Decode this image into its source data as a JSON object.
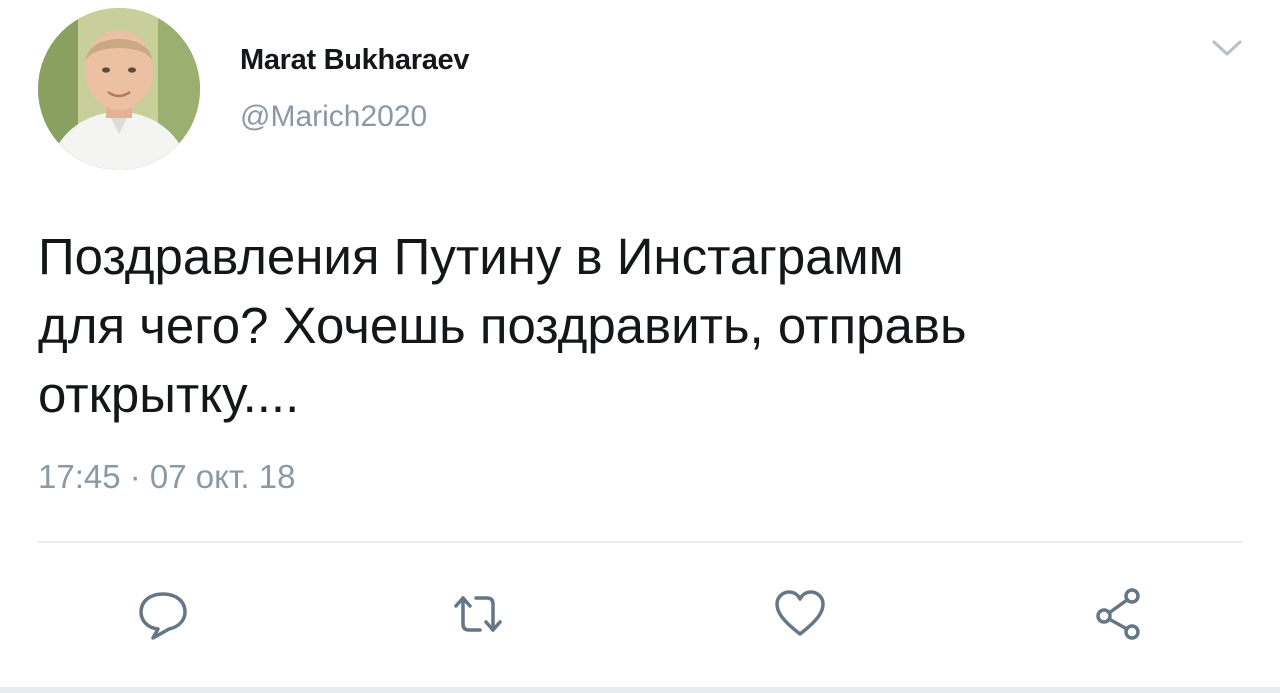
{
  "user": {
    "display_name": "Marat Bukharaev",
    "handle": "@Marich2020"
  },
  "tweet": {
    "text": "Поздравления Путину в Инстаграмм\nдля чего? Хочешь поздравить, отправь\nоткрытку....",
    "timestamp": "17:45 · 07 окт. 18"
  },
  "icons": {
    "menu": "chevron-down-icon",
    "reply": "reply-icon",
    "retweet": "retweet-icon",
    "like": "heart-icon",
    "share": "share-icon"
  },
  "colors": {
    "text": "#14171a",
    "secondary": "#8b98a5",
    "icon": "#657786",
    "divider": "#e6ecf0"
  }
}
